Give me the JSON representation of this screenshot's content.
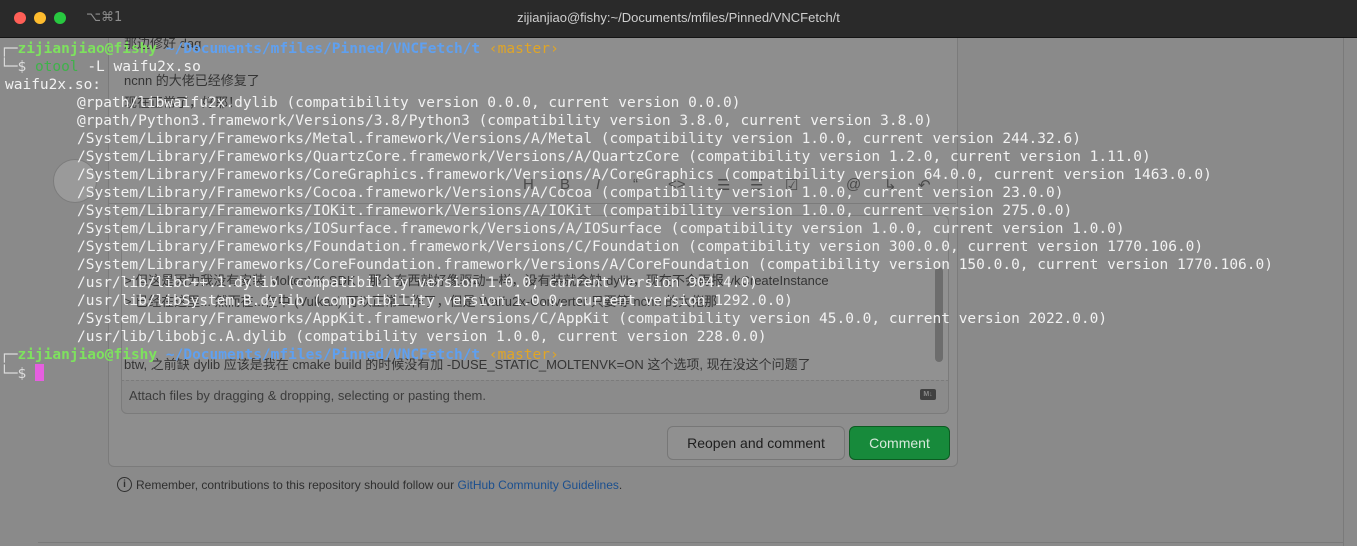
{
  "window": {
    "title": "zijianjiao@fishy:~/Documents/mfiles/Pinned/VNCFetch/t",
    "shortcut": "⌥⌘1"
  },
  "terminal": {
    "prompt1": {
      "corner": "┌─",
      "user": "zijianjiao@fishy",
      "path": "~/Documents/mfiles/Pinned/VNCFetch/t",
      "branch": "‹master›"
    },
    "command": {
      "corner": "└─$",
      "program": "otool",
      "args": "-L waifu2x.so"
    },
    "output_header": "waifu2x.so:",
    "output_lines": [
      "@rpath/libwaifu2x.dylib (compatibility version 0.0.0, current version 0.0.0)",
      "@rpath/Python3.framework/Versions/3.8/Python3 (compatibility version 3.8.0, current version 3.8.0)",
      "/System/Library/Frameworks/Metal.framework/Versions/A/Metal (compatibility version 1.0.0, current version 244.32.6)",
      "/System/Library/Frameworks/QuartzCore.framework/Versions/A/QuartzCore (compatibility version 1.2.0, current version 1.11.0)",
      "/System/Library/Frameworks/CoreGraphics.framework/Versions/A/CoreGraphics (compatibility version 64.0.0, current version 1463.0.0)",
      "/System/Library/Frameworks/Cocoa.framework/Versions/A/Cocoa (compatibility version 1.0.0, current version 23.0.0)",
      "/System/Library/Frameworks/IOKit.framework/Versions/A/IOKit (compatibility version 1.0.0, current version 275.0.0)",
      "/System/Library/Frameworks/IOSurface.framework/Versions/A/IOSurface (compatibility version 1.0.0, current version 1.0.0)",
      "/System/Library/Frameworks/Foundation.framework/Versions/C/Foundation (compatibility version 300.0.0, current version 1770.106.0)",
      "/System/Library/Frameworks/CoreFoundation.framework/Versions/A/CoreFoundation (compatibility version 150.0.0, current version 1770.106.0)",
      "/usr/lib/libc++.1.dylib (compatibility version 1.0.0, current version 904.4.0)",
      "/usr/lib/libSystem.B.dylib (compatibility version 1.0.0, current version 1292.0.0)",
      "/System/Library/Frameworks/AppKit.framework/Versions/C/AppKit (compatibility version 45.0.0, current version 2022.0.0)",
      "/usr/lib/libobjc.A.dylib (compatibility version 1.0.0, current version 228.0.0)"
    ],
    "prompt2": {
      "corner": "┌─",
      "user": "zijianjiao@fishy",
      "path": "~/Documents/mfiles/Pinned/VNCFetch/t",
      "branch": "‹master›"
    },
    "prompt2_corner": "└─$"
  },
  "background_page": {
    "comment_lines": [
      "那边修好 dag",
      "ncnn 的大佬已经修复了",
      "现在正常了，好耶！",
      "> 但这是因为我没有安装 MoltenVK SDK，那个东西就好像驱动一样，没有装就会缺 dylib，现在不会再报 vkCreateInstance",
      "> 已经在这里... 然而在...在中 (Vulkan) 可以正常工作了，但是 Waifu2x-Converter 只要等 ncnn 的大佬那",
      "btw, 之前缺 dylib 应该是我在 cmake build 的时候没有加 -DUSE_STATIC_MOLTENVK=ON 这个选项, 现在没这个问题了"
    ],
    "editor_toolbar": [
      "H",
      "B",
      "I",
      "“",
      "<>",
      "☰",
      "☰",
      "☑",
      "@",
      "↳",
      "↶"
    ],
    "attach_hint": "Attach files by dragging & dropping, selecting or pasting them.",
    "markdown_badge": "M↓",
    "reopen_button": "Reopen and comment",
    "comment_button": "Comment",
    "guidelines_prefix": "Remember, contributions to this repository should follow our",
    "guidelines_link": "GitHub Community Guidelines",
    "guidelines_suffix": "."
  }
}
